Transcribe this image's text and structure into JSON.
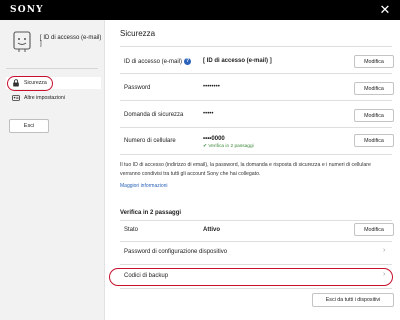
{
  "header": {
    "logo": "SONY"
  },
  "sidebar": {
    "user_id": "[ ID di accesso (e-mail) ]",
    "items": [
      {
        "label": "Sicurezza",
        "icon": "lock-icon",
        "active": true
      },
      {
        "label": "Altre impostazioni",
        "icon": "id-card-icon",
        "active": false
      }
    ],
    "logout_label": "Esci"
  },
  "main": {
    "title": "Sicurezza",
    "rows": [
      {
        "label": "ID di accesso (e-mail)",
        "value": "[ ID di accesso (e-mail) ]",
        "button": "Modifica"
      },
      {
        "label": "Password",
        "value": "••••••••",
        "button": "Modifica"
      },
      {
        "label": "Domanda di sicurezza",
        "value": "•••••",
        "button": "Modifica"
      },
      {
        "label": "Numero di cellulare",
        "value": "••••0000",
        "verified": "Verifica in 2 passaggi",
        "button": "Modifica"
      }
    ],
    "info_text": "Il tuo ID di accesso (indirizzo di email), la password, la domanda e risposta di sicurezza e i numeri di cellulare verranno condivisi tra tutti gli account Sony che hai collegato.",
    "more_info_link": "Maggiori informazioni",
    "two_step": {
      "heading": "Verifica in 2 passaggi",
      "state_label": "Stato",
      "state_value": "Attivo",
      "state_button": "Modifica",
      "device_setup_label": "Password di configurazione dispositivo",
      "backup_codes_label": "Codici di backup",
      "signout_all_button": "Esci da tutti i dispositivi"
    }
  },
  "colors": {
    "highlight": "#c8102e",
    "link": "#2b63b8",
    "verified": "#3c8a3c"
  }
}
